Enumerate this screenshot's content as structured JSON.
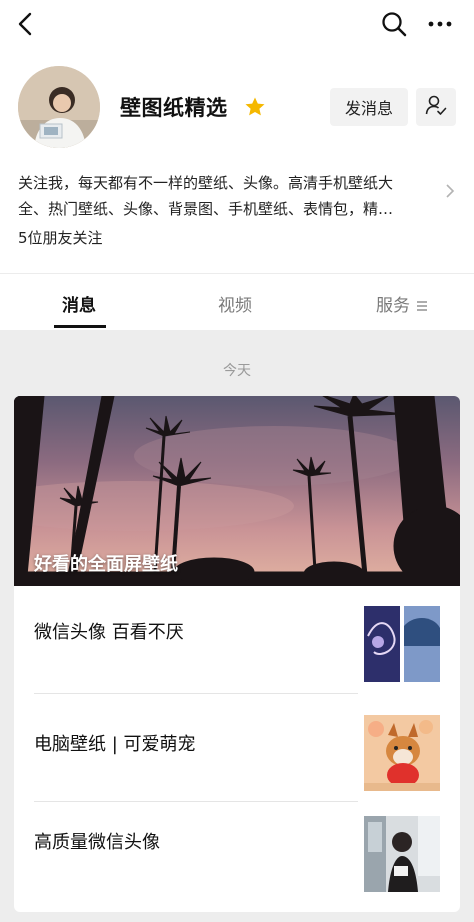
{
  "account": {
    "name": "壁图纸精选",
    "send_message_label": "发消息",
    "description_line1": "关注我，每天都有不一样的壁纸、头像。高清手机壁纸大",
    "description_line2": "全、热门壁纸、头像、背景图、手机壁纸、表情包，精…",
    "friends_following": "5位朋友关注"
  },
  "tabs": [
    {
      "label": "消息",
      "active": true
    },
    {
      "label": "视频",
      "active": false
    },
    {
      "label": "服务",
      "active": false
    }
  ],
  "feed": {
    "date": "今天",
    "cover_title": "好看的全面屏壁纸",
    "articles": [
      {
        "title": "微信头像 百看不厌"
      },
      {
        "title": "电脑壁纸 | 可爱萌宠"
      },
      {
        "title": "高质量微信头像"
      }
    ]
  },
  "icons": {
    "back": "back-arrow-icon",
    "search": "search-icon",
    "more": "more-dots-icon",
    "star": "star-icon",
    "follow_settings": "person-check-icon",
    "expand": "chevron-right-icon",
    "service_menu": "menu-lines-icon"
  },
  "colors": {
    "star": "#f5b800",
    "feed_background": "#ededed",
    "tab_active": "#111111",
    "tab_inactive": "#7a7a7a"
  }
}
